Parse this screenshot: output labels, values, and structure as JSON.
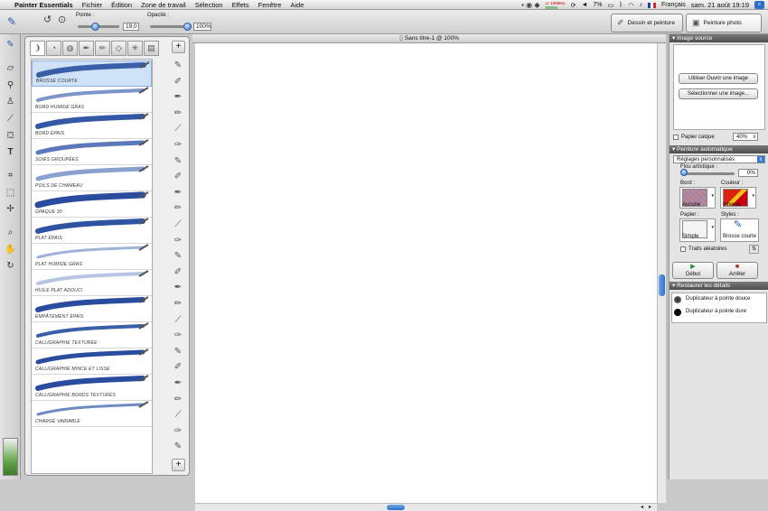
{
  "menubar": {
    "app": "Painter Essentials",
    "items": [
      "Fichier",
      "Édition",
      "Zone de travail",
      "Sélection",
      "Effets",
      "Fenêtre",
      "Aide"
    ],
    "status_top": "U: 1088Mo",
    "status_bottom": "958Mo",
    "battery": "7%",
    "language": "Français",
    "clock": "sam. 21 août  19:19"
  },
  "toolbar": {
    "pointe_label": "Pointe :",
    "pointe_value": "19,0",
    "pointe_level_pct": 45,
    "opacite_label": "Opacité :",
    "opacite_value": "100%",
    "opacite_level_pct": 100,
    "tab_dessin": "Dessin et peinture",
    "tab_photo": "Peinture photo"
  },
  "document": {
    "title": "Sans titre-1 @ 100%"
  },
  "brushes": {
    "items": [
      {
        "name": "BROSSE COURTE",
        "selected": true
      },
      {
        "name": "BORD HUMIDE GRAS"
      },
      {
        "name": "BORD ÉPAIS"
      },
      {
        "name": "SOIES GROUPÉES"
      },
      {
        "name": "POILS DE CHAMEAU"
      },
      {
        "name": "OPAQUE 30"
      },
      {
        "name": "PLAT ÉPAIS"
      },
      {
        "name": "PLAT HUMIDE GRAS"
      },
      {
        "name": "HUILE PLAT ADOUCI"
      },
      {
        "name": "EMPÂTEMENT ÉPAIS"
      },
      {
        "name": "CALLIGRAPHIE TEXTURÉE"
      },
      {
        "name": "CALLIGRAPHIE MINCE ET LISSE"
      },
      {
        "name": "CALLIGRAPHIE BORDS TEXTURÉS"
      },
      {
        "name": "CHARGÉ VARIABLE"
      }
    ]
  },
  "right_panel": {
    "image_source": {
      "title": "Image source",
      "open_button": "Utiliser Ouvrir une image",
      "select_button": "Sélectionner une image...",
      "papier_calque": "Papier calque",
      "opacity": "40%"
    },
    "peinture_auto": {
      "title": "Peinture automatique",
      "preset": "Réglages personnalisés",
      "flou_label": "Flou artistique :",
      "flou_value": "0%",
      "bord_label": "Bord :",
      "bord_value": "Aucune",
      "couleur_label": "Couleur :",
      "couleur_value": "Intense",
      "papier_label": "Papier :",
      "papier_value": "Simple",
      "styles_label": "Styles :",
      "styles_value": "Brosse courte",
      "traits_label": "Traits aléatoires",
      "start_button": "Début",
      "stop_button": "Arrêter"
    },
    "restaurer": {
      "title": "Restaurer les détails",
      "soft": "Duplicateur à pointe douce",
      "hard": "Duplicateur à pointe dure"
    }
  }
}
